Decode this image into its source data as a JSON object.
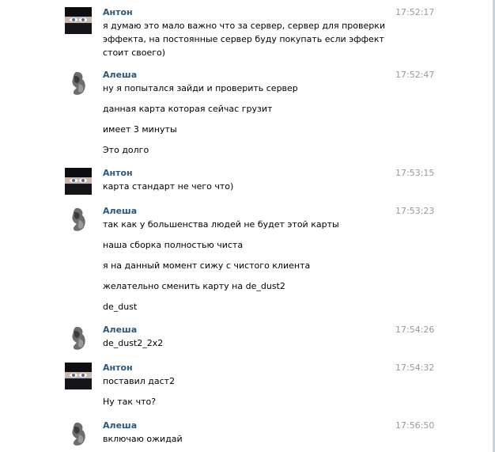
{
  "messages": [
    {
      "author": "Антон",
      "time": "17:52:17",
      "avatar": "anton-avatar",
      "lines": [
        "я думаю это мало важно что за сервер, сервер для проверки эффекта, на постоянные сервер буду покупать если эффект стоит своего)"
      ]
    },
    {
      "author": "Алеша",
      "time": "17:52:47",
      "avatar": "alesha-avatar",
      "lines": [
        "ну я попытался зайди и проверить сервер",
        "данная карта которая сейчас грузит",
        "имеет 3 минуты",
        "Это долго"
      ]
    },
    {
      "author": "Антон",
      "time": "17:53:15",
      "avatar": "anton-avatar",
      "lines": [
        "карта стандарт не чего что)"
      ]
    },
    {
      "author": "Алеша",
      "time": "17:53:23",
      "avatar": "alesha-avatar",
      "lines": [
        "так как у большенства людей не будет этой карты",
        "наша сборка полностью чиста",
        "я на данный момент сижу с чистого клиента",
        "желательно сменить карту на de_dust2",
        "de_dust"
      ]
    },
    {
      "author": "Алеша",
      "time": "17:54:26",
      "avatar": "alesha-avatar",
      "lines": [
        "de_dust2_2x2"
      ]
    },
    {
      "author": "Антон",
      "time": "17:54:32",
      "avatar": "anton-avatar",
      "lines": [
        "поставил даст2",
        "Ну так что?"
      ]
    },
    {
      "author": "Алеша",
      "time": "17:56:50",
      "avatar": "alesha-avatar",
      "lines": [
        "включаю ожидай"
      ]
    }
  ]
}
